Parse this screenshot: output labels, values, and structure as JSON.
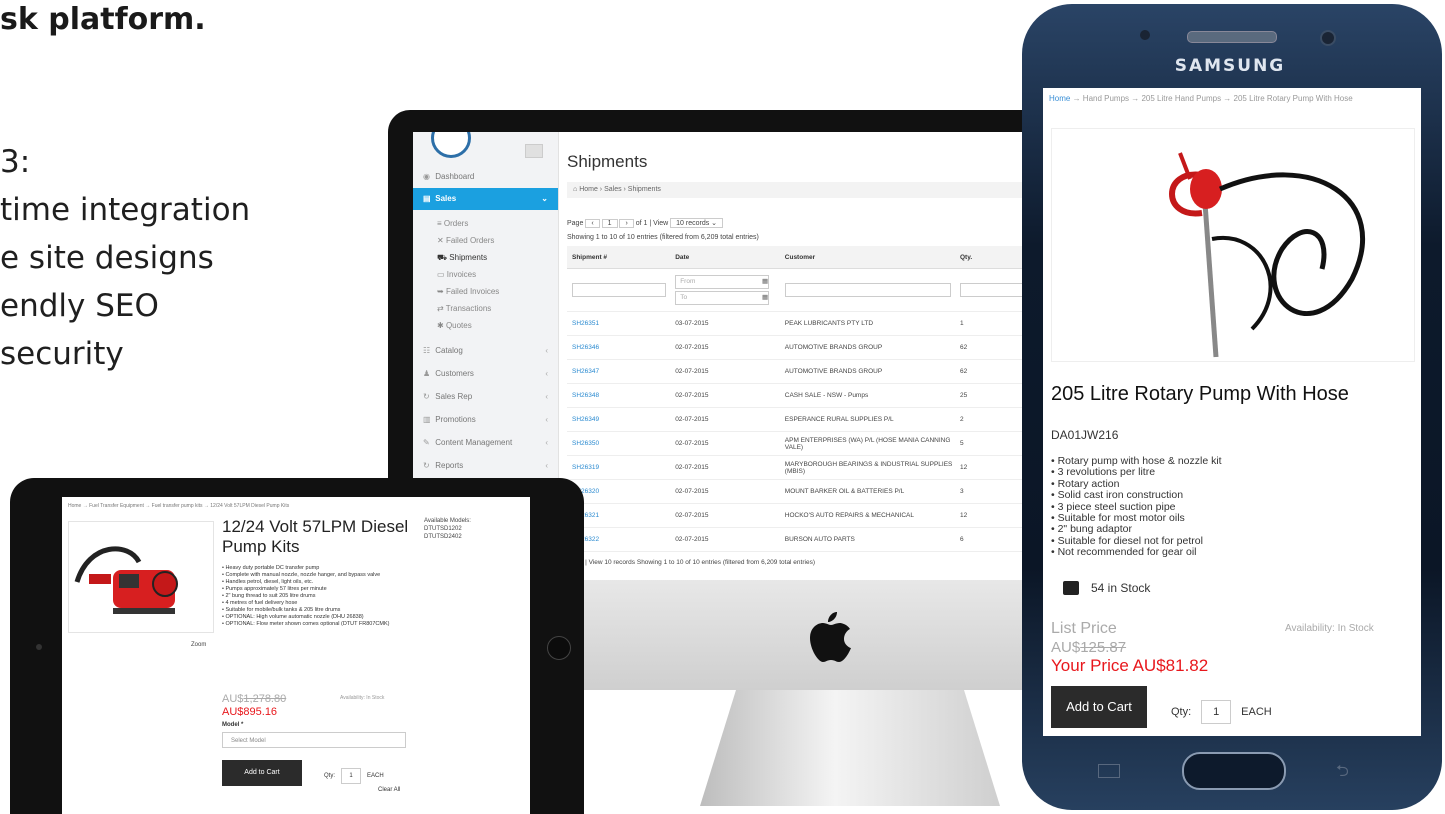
{
  "slide": {
    "title": "sk platform.",
    "bullets": [
      "3:",
      "time integration",
      "e site designs",
      "endly SEO",
      "security"
    ]
  },
  "admin": {
    "sidebar": {
      "items": [
        {
          "label": "Dashboard",
          "icon": "dashboard-icon"
        },
        {
          "label": "Sales",
          "icon": "sales-icon"
        },
        {
          "label": "Catalog",
          "icon": "catalog-icon"
        },
        {
          "label": "Customers",
          "icon": "customers-icon"
        },
        {
          "label": "Sales Rep",
          "icon": "sales-rep-icon"
        },
        {
          "label": "Promotions",
          "icon": "promotions-icon"
        },
        {
          "label": "Content Management",
          "icon": "content-icon"
        },
        {
          "label": "Reports",
          "icon": "reports-icon"
        }
      ],
      "sales_sub": [
        "Orders",
        "Failed Orders",
        "Shipments",
        "Invoices",
        "Failed Invoices",
        "Transactions",
        "Quotes"
      ]
    },
    "page_title": "Shipments",
    "breadcrumb": "Home › Sales › Shipments",
    "pager": {
      "page_label": "Page",
      "page": "1",
      "of": "of 1 | View",
      "view": "10 records"
    },
    "showing": "Showing 1 to 10 of 10 entries (filtered from 6,209 total entries)",
    "columns": [
      "Shipment #",
      "Date",
      "Customer",
      "Qty."
    ],
    "filter_from": "From",
    "filter_to": "To",
    "rows": [
      {
        "id": "SH26351",
        "date": "03-07-2015",
        "customer": "PEAK LUBRICANTS PTY LTD",
        "qty": "1"
      },
      {
        "id": "SH26346",
        "date": "02-07-2015",
        "customer": "AUTOMOTIVE BRANDS GROUP",
        "qty": "62"
      },
      {
        "id": "SH26347",
        "date": "02-07-2015",
        "customer": "AUTOMOTIVE BRANDS GROUP",
        "qty": "62"
      },
      {
        "id": "SH26348",
        "date": "02-07-2015",
        "customer": "CASH SALE - NSW - Pumps",
        "qty": "25"
      },
      {
        "id": "SH26349",
        "date": "02-07-2015",
        "customer": "ESPERANCE RURAL SUPPLIES P/L",
        "qty": "2"
      },
      {
        "id": "SH26350",
        "date": "02-07-2015",
        "customer": "APM ENTERPRISES (WA) P/L (HOSE MANIA CANNING VALE)",
        "qty": "5"
      },
      {
        "id": "SH26319",
        "date": "02-07-2015",
        "customer": "MARYBOROUGH BEARINGS & INDUSTRIAL SUPPLIES (MBIS)",
        "qty": "12"
      },
      {
        "id": "SH26320",
        "date": "02-07-2015",
        "customer": "MOUNT BARKER OIL & BATTERIES P/L",
        "qty": "3"
      },
      {
        "id": "SH26321",
        "date": "02-07-2015",
        "customer": "HOCKO'S AUTO REPAIRS & MECHANICAL",
        "qty": "12"
      },
      {
        "id": "SH26322",
        "date": "02-07-2015",
        "customer": "BURSON AUTO PARTS",
        "qty": "6"
      }
    ],
    "footer": "1  of 1 | View  10 records     Showing 1 to 10 of 10 entries (filtered from 6,209 total entries)"
  },
  "tablet": {
    "breadcrumb": "Home → Fuel Transfer Equipment → Fuel transfer pump kits → 12/24 Volt 57LPM Diesel Pump Kits",
    "title": "12/24 Volt 57LPM Diesel Pump Kits",
    "available_models": [
      "Available Models:",
      "DTUTSD1202",
      "DTUTSD2402"
    ],
    "features": [
      "• Heavy duty portable DC transfer pump",
      "• Complete with manual nozzle, nozzle hanger, and bypass valve",
      "• Handles petrol, diesel, light oils, etc.",
      "• Pumps approximately 57 litres per minute",
      "• 2\" bung thread to suit 205 litre drums",
      "• 4 metres of fuel delivery hose",
      "• Suitable for mobile/bulk tanks & 205 litre drums",
      "• OPTIONAL: High volume automatic nozzle (DHU 26838)",
      "• OPTIONAL: Flow meter shown comes optional (DTUT FR807CMK)"
    ],
    "zoom": "Zoom",
    "currency": "AU$",
    "list_price": "1,278.80",
    "availability": "Availability: In Stock",
    "your_price": "895.16",
    "model_label": "Model *",
    "model_placeholder": "Select Model",
    "add_to_cart": "Add to Cart",
    "qty_label": "Qty:",
    "qty_value": "1",
    "unit": "EACH",
    "clear_all": "Clear All"
  },
  "phone": {
    "brand": "SAMSUNG",
    "breadcrumb_home": "Home",
    "breadcrumb_rest": " → Hand Pumps → 205 Litre Hand Pumps → 205 Litre Rotary Pump With Hose",
    "title": "205 Litre Rotary Pump With Hose",
    "sku": "DA01JW216",
    "features": [
      "• Rotary pump with hose & nozzle kit",
      "• 3 revolutions per litre",
      "• Rotary action",
      "• Solid cast iron construction",
      "• 3 piece steel suction pipe",
      "• Suitable for most motor oils",
      "• 2\" bung adaptor",
      "• Suitable for diesel not for petrol",
      "• Not recommended for gear oil"
    ],
    "stock": "54 in Stock",
    "list_price_label": "List Price",
    "availability": "Availability: In Stock",
    "currency": "AU$",
    "list_price": "125.87",
    "your_price_label": "Your Price ",
    "your_price": "81.82",
    "add_to_cart": "Add to Cart",
    "qty_label": "Qty:",
    "qty_value": "1",
    "unit": "EACH"
  }
}
